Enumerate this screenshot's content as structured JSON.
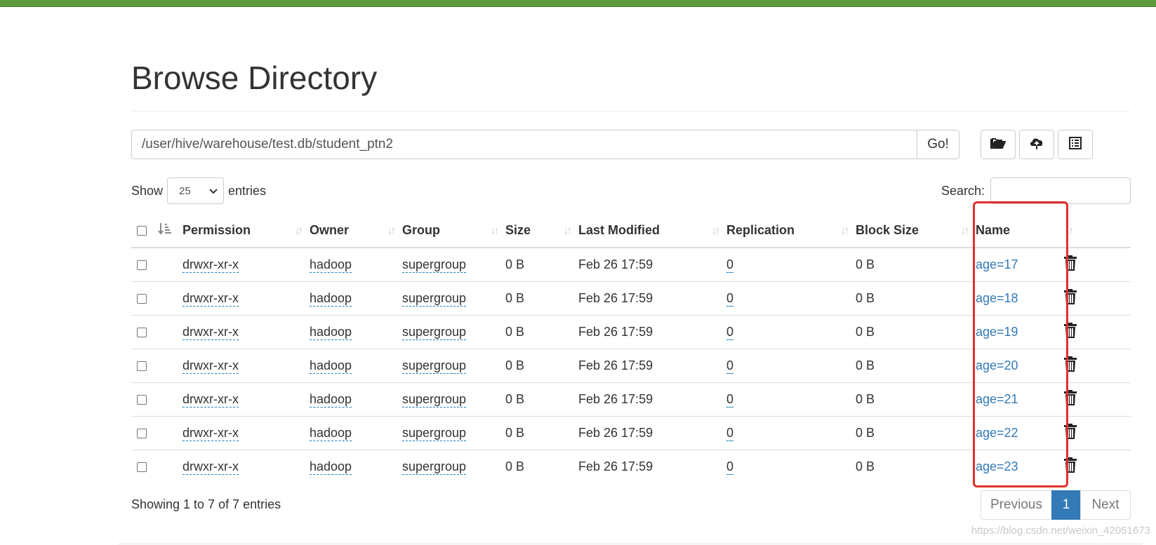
{
  "page": {
    "title": "Browse Directory"
  },
  "path_bar": {
    "value": "/user/hive/warehouse/test.db/student_ptn2",
    "go_label": "Go!"
  },
  "toolbar": {
    "icons": [
      "folder-open-icon",
      "cloud-upload-icon",
      "list-alt-icon"
    ]
  },
  "length_menu": {
    "show_label": "Show",
    "selected": "25",
    "entries_label": "entries"
  },
  "search": {
    "label": "Search:",
    "value": ""
  },
  "table": {
    "columns": [
      "Permission",
      "Owner",
      "Group",
      "Size",
      "Last Modified",
      "Replication",
      "Block Size",
      "Name"
    ],
    "rows": [
      {
        "permission": "drwxr-xr-x",
        "owner": "hadoop",
        "group": "supergroup",
        "size": "0 B",
        "modified": "Feb 26 17:59",
        "replication": "0",
        "block_size": "0 B",
        "name": "age=17"
      },
      {
        "permission": "drwxr-xr-x",
        "owner": "hadoop",
        "group": "supergroup",
        "size": "0 B",
        "modified": "Feb 26 17:59",
        "replication": "0",
        "block_size": "0 B",
        "name": "age=18"
      },
      {
        "permission": "drwxr-xr-x",
        "owner": "hadoop",
        "group": "supergroup",
        "size": "0 B",
        "modified": "Feb 26 17:59",
        "replication": "0",
        "block_size": "0 B",
        "name": "age=19"
      },
      {
        "permission": "drwxr-xr-x",
        "owner": "hadoop",
        "group": "supergroup",
        "size": "0 B",
        "modified": "Feb 26 17:59",
        "replication": "0",
        "block_size": "0 B",
        "name": "age=20"
      },
      {
        "permission": "drwxr-xr-x",
        "owner": "hadoop",
        "group": "supergroup",
        "size": "0 B",
        "modified": "Feb 26 17:59",
        "replication": "0",
        "block_size": "0 B",
        "name": "age=21"
      },
      {
        "permission": "drwxr-xr-x",
        "owner": "hadoop",
        "group": "supergroup",
        "size": "0 B",
        "modified": "Feb 26 17:59",
        "replication": "0",
        "block_size": "0 B",
        "name": "age=22"
      },
      {
        "permission": "drwxr-xr-x",
        "owner": "hadoop",
        "group": "supergroup",
        "size": "0 B",
        "modified": "Feb 26 17:59",
        "replication": "0",
        "block_size": "0 B",
        "name": "age=23"
      }
    ]
  },
  "footer": {
    "info": "Showing 1 to 7 of 7 entries",
    "previous": "Previous",
    "current_page": "1",
    "next": "Next"
  },
  "watermark": "https://blog.csdn.net/weixin_42051673",
  "colors": {
    "top_bar": "#5e9a3e",
    "link": "#337ab7",
    "highlight_box": "#e0302b",
    "active_page": "#337ab7"
  }
}
